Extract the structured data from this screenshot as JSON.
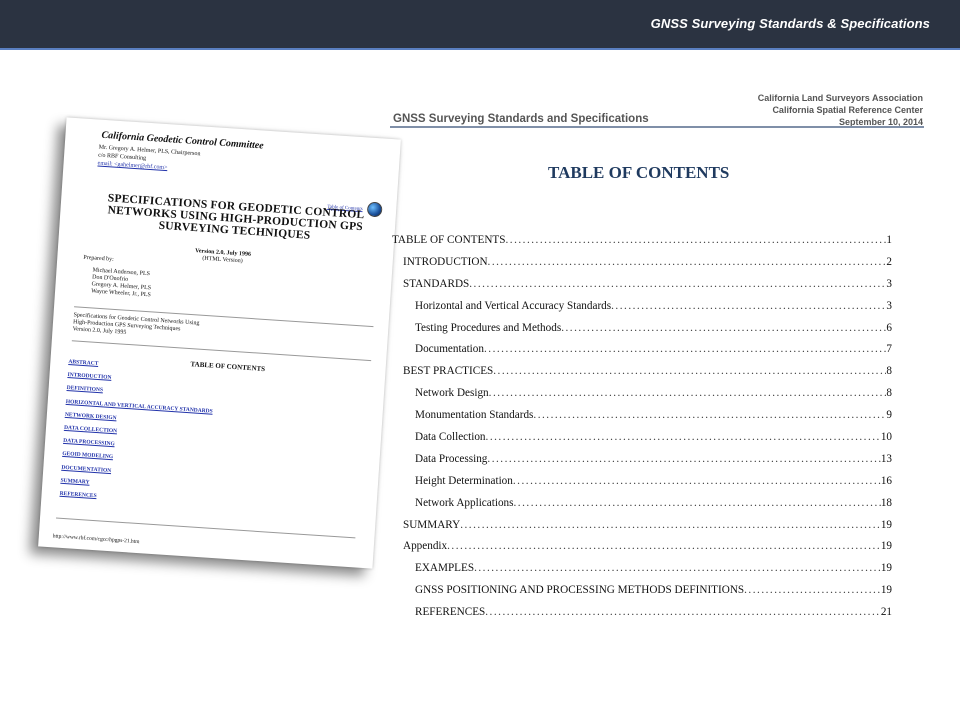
{
  "header": {
    "title": "GNSS Surveying Standards & Specifications"
  },
  "old_document": {
    "committee": "California Geodetic Control Committee",
    "contact_lines": [
      "Mr. Gregory A. Helmer, PLS, Chairperson",
      "c/o RBF Consulting",
      "email: <gahelmer@rbf.com>"
    ],
    "toc_link": "Table of Contents",
    "title_lines": [
      "SPECIFICATIONS FOR GEODETIC CONTROL",
      "NETWORKS USING HIGH-PRODUCTION GPS",
      "SURVEYING TECHNIQUES"
    ],
    "version_line1": "Version 2.0, July 1996",
    "version_line2": "(HTML Version)",
    "prepared_by": "Prepared by:",
    "people": [
      "Michael Anderson, PLS",
      "Don D'Onofrio",
      "Gregory A. Helmer, PLS",
      "Wayne Wheeler, Jr., PLS"
    ],
    "citation_lines": [
      "Specifications for Geodetic Control Networks Using",
      "High-Production GPS Surveying Techniques",
      "Version 2.0, July 1995"
    ],
    "toc_heading": "TABLE OF CONTENTS",
    "links": [
      "ABSTRACT",
      "INTRODUCTION",
      "DEFINITIONS",
      "HORIZONTAL AND VERTICAL ACCURACY STANDARDS",
      "NETWORK DESIGN",
      "DATA COLLECTION",
      "DATA PROCESSING",
      "GEOID MODELING",
      "DOCUMENTATION",
      "SUMMARY",
      "REFERENCES"
    ],
    "url": "http://www.rbf.com/cgcc/hpgps-21.htm"
  },
  "new_document": {
    "title": "GNSS Surveying Standards and Specifications",
    "org1": "California Land Surveyors Association",
    "org2": "California Spatial Reference Center",
    "date": "September 10, 2014",
    "toc_heading": "TABLE OF CONTENTS",
    "entries": [
      {
        "label": "TABLE OF CONTENTS",
        "page": "1",
        "level": 0
      },
      {
        "label": "INTRODUCTION",
        "page": "2",
        "level": 1
      },
      {
        "label": "STANDARDS",
        "page": "3",
        "level": 1
      },
      {
        "label": "Horizontal and Vertical Accuracy Standards",
        "page": "3",
        "level": 2
      },
      {
        "label": "Testing Procedures and Methods",
        "page": "6",
        "level": 2
      },
      {
        "label": "Documentation",
        "page": "7",
        "level": 2
      },
      {
        "label": "BEST PRACTICES",
        "page": "8",
        "level": 1
      },
      {
        "label": "Network Design",
        "page": "8",
        "level": 2
      },
      {
        "label": "Monumentation Standards",
        "page": "9",
        "level": 2
      },
      {
        "label": "Data Collection",
        "page": "10",
        "level": 2
      },
      {
        "label": "Data Processing",
        "page": "13",
        "level": 2
      },
      {
        "label": "Height Determination",
        "page": "16",
        "level": 2
      },
      {
        "label": "Network Applications",
        "page": "18",
        "level": 2
      },
      {
        "label": "SUMMARY",
        "page": "19",
        "level": 1
      },
      {
        "label": "Appendix",
        "page": "19",
        "level": 1
      },
      {
        "label": "EXAMPLES",
        "page": "19",
        "level": 2
      },
      {
        "label": "GNSS POSITIONING AND PROCESSING METHODS DEFINITIONS",
        "page": "19",
        "level": 2
      },
      {
        "label": "REFERENCES",
        "page": "21",
        "level": 2
      }
    ]
  }
}
